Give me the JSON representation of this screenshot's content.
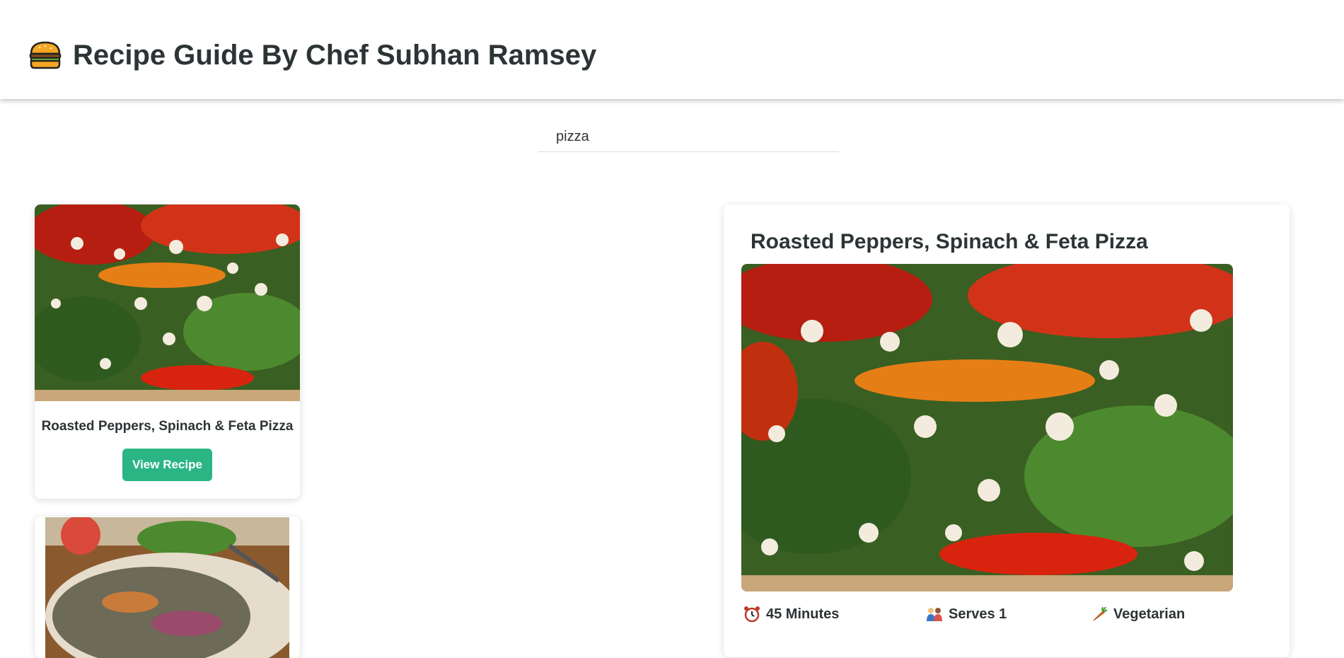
{
  "app": {
    "title": "Recipe Guide By Chef Subhan Ramsey",
    "logo_icon": "burger-icon"
  },
  "search": {
    "value": "pizza",
    "placeholder": ""
  },
  "results": [
    {
      "title": "Roasted Peppers, Spinach & Feta Pizza",
      "button_label": "View Recipe",
      "image": "pizza-photo"
    },
    {
      "title": "",
      "image": "pizza-photo-2"
    }
  ],
  "detail": {
    "title": "Roasted Peppers, Spinach & Feta Pizza",
    "image": "pizza-photo",
    "time": "45 Minutes",
    "serves": "Serves 1",
    "diet": "Vegetarian"
  },
  "colors": {
    "accent": "#2bb585",
    "text": "#2d3436"
  }
}
